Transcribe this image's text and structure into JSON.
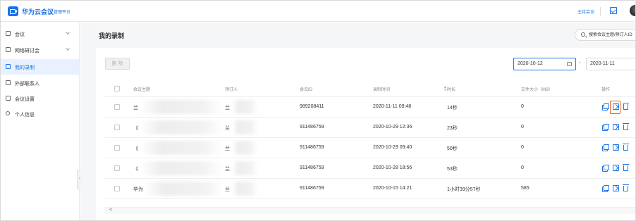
{
  "header": {
    "brand": "华为云会议",
    "brand_sub": "管理平台",
    "host_meeting": "主持会议"
  },
  "sidebar": {
    "items": [
      {
        "label": "会议",
        "icon": "meeting-icon",
        "expandable": true,
        "active": false
      },
      {
        "label": "网络研讨会",
        "icon": "webinar-icon",
        "expandable": true,
        "active": false
      },
      {
        "label": "我的录制",
        "icon": "recording-icon",
        "expandable": false,
        "active": true
      },
      {
        "label": "外部联系人",
        "icon": "contact-icon",
        "expandable": false,
        "active": false
      },
      {
        "label": "会议设置",
        "icon": "settings-icon",
        "expandable": false,
        "active": false
      },
      {
        "label": "个人信息",
        "icon": "person-icon",
        "expandable": false,
        "active": false
      }
    ]
  },
  "main": {
    "page_title": "我的录制",
    "search_placeholder": "搜索会议主题/预订人ID",
    "delete_label": "删 除",
    "date_start": "2020-10-12",
    "date_separator": "-",
    "date_end": "2020-11-11",
    "columns": [
      "会议主题",
      "预订人",
      "会议ID",
      "录制时间",
      "时长",
      "文件大小（MB）",
      "操作"
    ],
    "rows": [
      {
        "subject": "兰",
        "booker": "兰",
        "meeting_id": "989208411",
        "record_time": "2020-11-11 09:48",
        "duration": "14秒",
        "size": "0"
      },
      {
        "subject": "《",
        "booker": "兰",
        "meeting_id": "911486759",
        "record_time": "2020-10-29 12:36",
        "duration": "23秒",
        "size": "0"
      },
      {
        "subject": "《",
        "booker": "兰",
        "meeting_id": "911486759",
        "record_time": "2020-10-29 09:40",
        "duration": "50秒",
        "size": "0"
      },
      {
        "subject": "《",
        "booker": "兰",
        "meeting_id": "911486759",
        "record_time": "2020-10-28 18:56",
        "duration": "53秒",
        "size": "0"
      },
      {
        "subject": "华为",
        "booker": "兰",
        "meeting_id": "911486759",
        "record_time": "2020-10-15 14:21",
        "duration": "1小时39分57秒",
        "size": "585"
      }
    ],
    "scroll_left": "<"
  },
  "colors": {
    "accent": "#1a73e8",
    "highlight": "#e8621a",
    "active_bg": "#e8f1fd",
    "page_bg": "#f5f6f8"
  }
}
